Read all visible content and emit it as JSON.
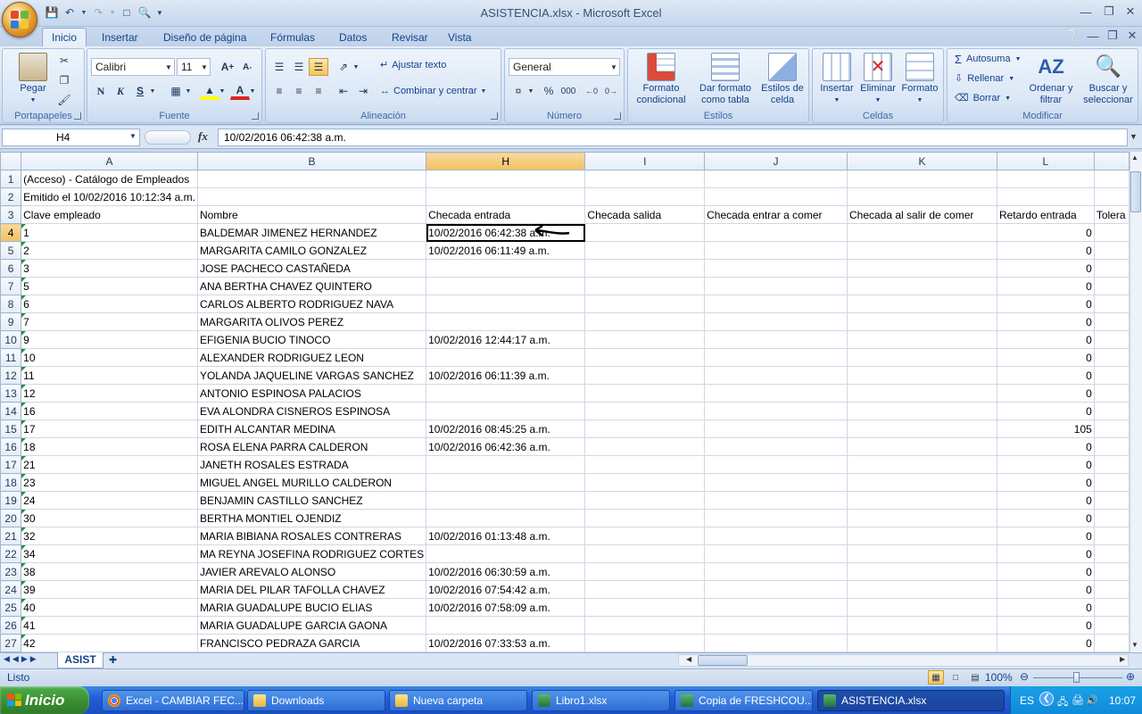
{
  "window": {
    "title": "ASISTENCIA.xlsx - Microsoft Excel"
  },
  "ribbon_tabs": [
    "Inicio",
    "Insertar",
    "Diseño de página",
    "Fórmulas",
    "Datos",
    "Revisar",
    "Vista"
  ],
  "active_tab": "Inicio",
  "clipboard": {
    "paste_label": "Pegar",
    "group_label": "Portapapeles"
  },
  "font": {
    "name": "Calibri",
    "size": "11",
    "bold": "N",
    "italic": "K",
    "underline": "S",
    "group_label": "Fuente"
  },
  "alignment": {
    "wrap_label": "Ajustar texto",
    "merge_label": "Combinar y centrar",
    "group_label": "Alineación"
  },
  "number": {
    "format": "General",
    "percent": "%",
    "thousands": "000",
    "group_label": "Número"
  },
  "styles": {
    "conditional_label": "Formato condicional",
    "table_label": "Dar formato como tabla",
    "cell_styles_label": "Estilos de celda",
    "group_label": "Estilos"
  },
  "cells": {
    "insert_label": "Insertar",
    "delete_label": "Eliminar",
    "format_label": "Formato",
    "group_label": "Celdas"
  },
  "editing": {
    "autosum_label": "Autosuma",
    "fill_label": "Rellenar",
    "clear_label": "Borrar",
    "sort_label": "Ordenar y filtrar",
    "find_label": "Buscar y seleccionar",
    "group_label": "Modificar"
  },
  "formula_bar": {
    "name_box": "H4",
    "fx": "fx",
    "content": "10/02/2016 06:42:38 a.m."
  },
  "columns": [
    "A",
    "B",
    "H",
    "I",
    "J",
    "K",
    "L"
  ],
  "selected_column": "H",
  "rows": [
    {
      "n": "1",
      "a": "(Acceso) - Catálogo de Empleados",
      "b": "",
      "h": "",
      "i": "",
      "j": "",
      "k": "",
      "l": "",
      "l2": ""
    },
    {
      "n": "2",
      "a": "Emitido el 10/02/2016 10:12:34 a.m.",
      "b": "",
      "h": "",
      "i": "",
      "j": "",
      "k": "",
      "l": "",
      "l2": ""
    },
    {
      "n": "3",
      "a": "Clave empleado",
      "b": "Nombre",
      "h": "Checada entrada",
      "i": "Checada salida",
      "j": "Checada entrar a comer",
      "k": "Checada al salir de comer",
      "l": "Retardo entrada",
      "l2": "Tolera"
    },
    {
      "n": "4",
      "a": "1",
      "b": "BALDEMAR JIMENEZ HERNANDEZ",
      "h": "10/02/2016 06:42:38 a.m.",
      "i": "",
      "j": "",
      "k": "",
      "l": "0",
      "l2": ""
    },
    {
      "n": "5",
      "a": "2",
      "b": "MARGARITA CAMILO GONZALEZ",
      "h": "10/02/2016 06:11:49 a.m.",
      "i": "",
      "j": "",
      "k": "",
      "l": "0",
      "l2": ""
    },
    {
      "n": "6",
      "a": "3",
      "b": "JOSE PACHECO CASTAÑEDA",
      "h": "",
      "i": "",
      "j": "",
      "k": "",
      "l": "0",
      "l2": ""
    },
    {
      "n": "7",
      "a": "5",
      "b": "ANA BERTHA CHAVEZ QUINTERO",
      "h": "",
      "i": "",
      "j": "",
      "k": "",
      "l": "0",
      "l2": ""
    },
    {
      "n": "8",
      "a": "6",
      "b": "CARLOS ALBERTO RODRIGUEZ  NAVA",
      "h": "",
      "i": "",
      "j": "",
      "k": "",
      "l": "0",
      "l2": ""
    },
    {
      "n": "9",
      "a": "7",
      "b": "MARGARITA OLIVOS PEREZ",
      "h": "",
      "i": "",
      "j": "",
      "k": "",
      "l": "0",
      "l2": ""
    },
    {
      "n": "10",
      "a": "9",
      "b": "EFIGENIA BUCIO TINOCO",
      "h": "10/02/2016 12:44:17 a.m.",
      "i": "",
      "j": "",
      "k": "",
      "l": "0",
      "l2": ""
    },
    {
      "n": "11",
      "a": "10",
      "b": "ALEXANDER RODRIGUEZ LEON",
      "h": "",
      "i": "",
      "j": "",
      "k": "",
      "l": "0",
      "l2": ""
    },
    {
      "n": "12",
      "a": "11",
      "b": "YOLANDA JAQUELINE VARGAS SANCHEZ",
      "h": "10/02/2016 06:11:39 a.m.",
      "i": "",
      "j": "",
      "k": "",
      "l": "0",
      "l2": ""
    },
    {
      "n": "13",
      "a": "12",
      "b": "ANTONIO ESPINOSA PALACIOS",
      "h": "",
      "i": "",
      "j": "",
      "k": "",
      "l": "0",
      "l2": ""
    },
    {
      "n": "14",
      "a": "16",
      "b": "EVA ALONDRA CISNEROS ESPINOSA",
      "h": "",
      "i": "",
      "j": "",
      "k": "",
      "l": "0",
      "l2": ""
    },
    {
      "n": "15",
      "a": "17",
      "b": "EDITH ALCANTAR MEDINA",
      "h": "10/02/2016 08:45:25 a.m.",
      "i": "",
      "j": "",
      "k": "",
      "l": "105",
      "l2": ""
    },
    {
      "n": "16",
      "a": "18",
      "b": "ROSA ELENA PARRA CALDERON",
      "h": "10/02/2016 06:42:36 a.m.",
      "i": "",
      "j": "",
      "k": "",
      "l": "0",
      "l2": ""
    },
    {
      "n": "17",
      "a": "21",
      "b": "JANETH ROSALES ESTRADA",
      "h": "",
      "i": "",
      "j": "",
      "k": "",
      "l": "0",
      "l2": ""
    },
    {
      "n": "18",
      "a": "23",
      "b": "MIGUEL ANGEL  MURILLO CALDERON",
      "h": "",
      "i": "",
      "j": "",
      "k": "",
      "l": "0",
      "l2": ""
    },
    {
      "n": "19",
      "a": "24",
      "b": "BENJAMIN CASTILLO SANCHEZ",
      "h": "",
      "i": "",
      "j": "",
      "k": "",
      "l": "0",
      "l2": ""
    },
    {
      "n": "20",
      "a": "30",
      "b": "BERTHA MONTIEL OJENDIZ",
      "h": "",
      "i": "",
      "j": "",
      "k": "",
      "l": "0",
      "l2": ""
    },
    {
      "n": "21",
      "a": "32",
      "b": "MARIA BIBIANA ROSALES  CONTRERAS",
      "h": "10/02/2016 01:13:48 a.m.",
      "i": "",
      "j": "",
      "k": "",
      "l": "0",
      "l2": ""
    },
    {
      "n": "22",
      "a": "34",
      "b": "MA REYNA JOSEFINA RODRIGUEZ CORTES",
      "h": "",
      "i": "",
      "j": "",
      "k": "",
      "l": "0",
      "l2": ""
    },
    {
      "n": "23",
      "a": "38",
      "b": "JAVIER AREVALO ALONSO",
      "h": "10/02/2016 06:30:59 a.m.",
      "i": "",
      "j": "",
      "k": "",
      "l": "0",
      "l2": ""
    },
    {
      "n": "24",
      "a": "39",
      "b": "MARIA DEL PILAR TAFOLLA CHAVEZ",
      "h": "10/02/2016 07:54:42 a.m.",
      "i": "",
      "j": "",
      "k": "",
      "l": "0",
      "l2": ""
    },
    {
      "n": "25",
      "a": "40",
      "b": "MARIA GUADALUPE BUCIO ELIAS",
      "h": "10/02/2016 07:58:09 a.m.",
      "i": "",
      "j": "",
      "k": "",
      "l": "0",
      "l2": ""
    },
    {
      "n": "26",
      "a": "41",
      "b": "MARIA GUADALUPE GARCIA GAONA",
      "h": "",
      "i": "",
      "j": "",
      "k": "",
      "l": "0",
      "l2": ""
    },
    {
      "n": "27",
      "a": "42",
      "b": "FRANCISCO  PEDRAZA GARCIA",
      "h": "10/02/2016 07:33:53 a.m.",
      "i": "",
      "j": "",
      "k": "",
      "l": "0",
      "l2": ""
    }
  ],
  "sheet_tab": "ASIST",
  "status": {
    "text": "Listo",
    "zoom": "100%"
  },
  "taskbar": {
    "start_label": "Inicio",
    "items": [
      "Excel - CAMBIAR FEC...",
      "Downloads",
      "Nueva carpeta",
      "Libro1.xlsx",
      "Copia de FRESHCOU...",
      "ASISTENCIA.xlsx"
    ],
    "lang": "ES",
    "clock": "10:07"
  },
  "colors": {
    "accent": "#15428b",
    "selected_header": "#f1c15f",
    "taskbar": "#245edb"
  }
}
